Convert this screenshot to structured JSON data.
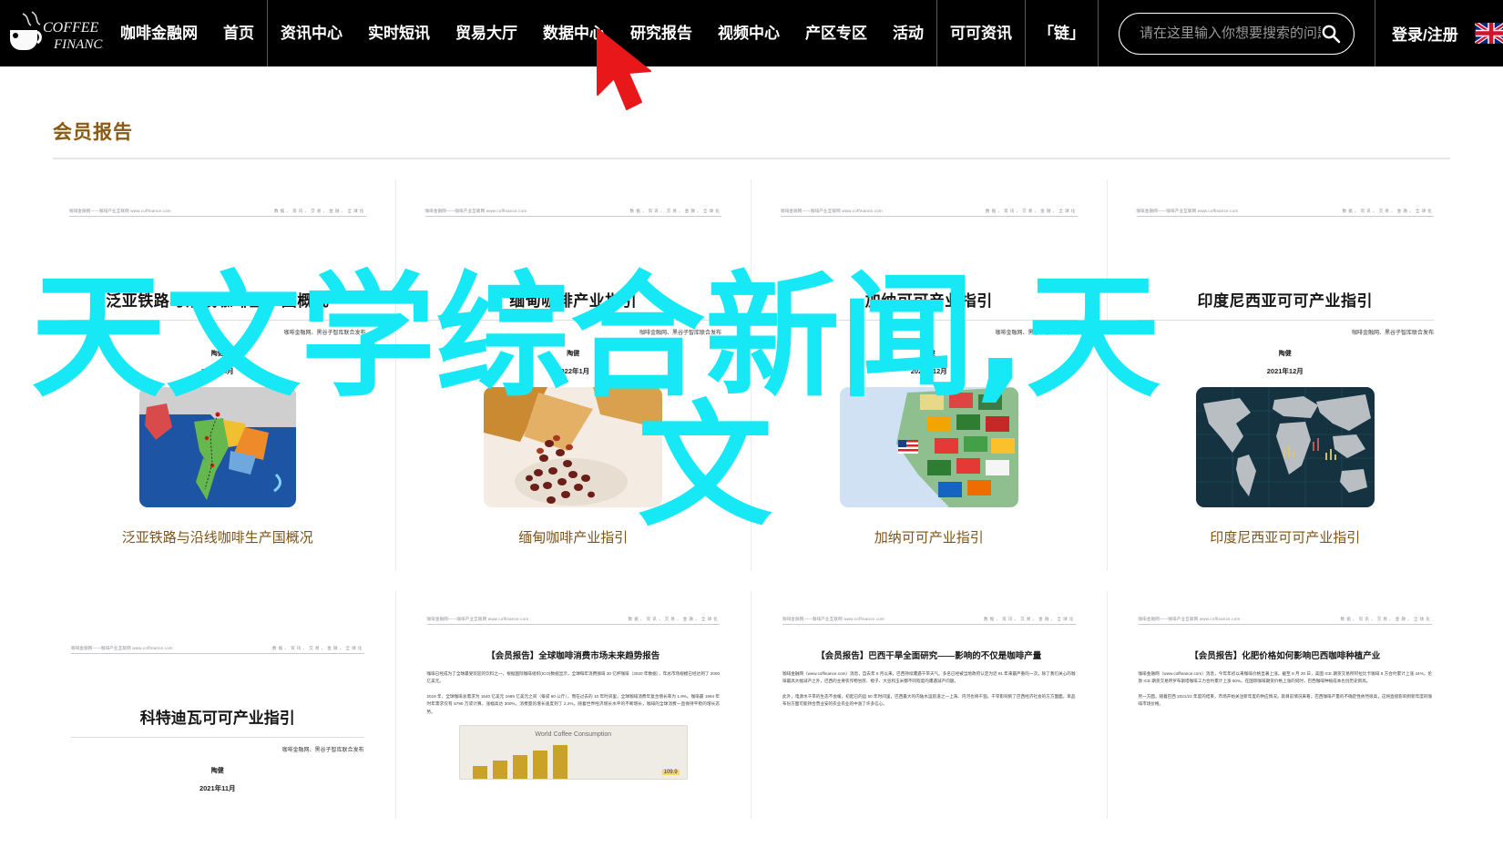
{
  "navbar": {
    "logo_text_top": "COFFEE",
    "logo_text_bottom": "FINANCE",
    "logo_icon": "coffee-cup-icon",
    "brand_items": [
      "咖啡金融网",
      "首页"
    ],
    "menu_items": [
      "资讯中心",
      "实时短讯",
      "贸易大厅",
      "数据中心",
      "研究报告",
      "视频中心",
      "产区专区",
      "活动"
    ],
    "menu_items_right": [
      "可可资讯",
      "「链」"
    ],
    "search": {
      "placeholder": "请在这里输入你想要搜索的问题",
      "value": "",
      "icon": "search-icon"
    },
    "login_label": "登录/注册",
    "flag_icon": "uk-flag-icon",
    "background_color": "#000000",
    "text_color": "#ffffff"
  },
  "page": {
    "section_title": "会员报告",
    "title_color": "#8a5a12",
    "cursor_icon": "mouse-pointer-arrow",
    "cursor_color": "#e8171a"
  },
  "watermark": {
    "line1": "天文学综合新闻,天",
    "line2": "文",
    "color": "#16e8f5"
  },
  "doc_header": {
    "left": "咖啡金融网——咖啡产业互联网 www.coffinance.com",
    "right": "数据、资讯、交易、金融、全球化"
  },
  "reports": [
    {
      "title": "泛亚铁路与沿线咖啡生产国概况",
      "caption": "泛亚铁路与沿线咖啡生产国概况",
      "publisher": "咖啡金融网、黑谷子智库联合发布",
      "author": "陶健",
      "date": "2022年4月",
      "image": "southeast-asia-railway-map"
    },
    {
      "title": "缅甸咖啡产业指引",
      "caption": "缅甸咖啡产业指引",
      "publisher": "咖啡金融网、黑谷子智库联合发布",
      "author": "陶健",
      "date": "2022年1月",
      "image": "coffee-cherries-photo"
    },
    {
      "title": "加纳可可产业指引",
      "caption": "加纳可可产业指引",
      "publisher": "咖啡金融网、黑谷子智库联合发布",
      "author": "陶健",
      "date": "2021年12月",
      "image": "west-africa-flags-map"
    },
    {
      "title": "印度尼西亚可可产业指引",
      "caption": "印度尼西亚可可产业指引",
      "publisher": "咖啡金融网、黑谷子智库联合发布",
      "author": "陶健",
      "date": "2021年12月",
      "image": "dark-world-map"
    }
  ],
  "articles": [
    {
      "title": "科特迪瓦可可可产业指引",
      "title_display": "科特迪瓦可可产业指引",
      "publisher": "咖啡金融网、黑谷子智库联合发布",
      "author": "陶健",
      "date": "2021年11月",
      "type": "cover"
    },
    {
      "title": "【会员报告】全球咖啡消费市场未来趋势报告",
      "para1": "咖啡已经成为了全球最受欢迎的饮料之一。根据国际咖啡组织(ICO)数据显示，全球每年消费咖啡 30 亿杯咖啡（2020 年数据），年总市场规模已经达到了 2000 亿美元。",
      "para2": "2019 年，全球咖啡总需求为 1640 亿美元 1665 亿美元之间（每袋 60 公斤），而在过去的 10 年时间里，全球咖啡消费年复合增长率为 1.9%。咖啡最 1964 年时年需求仅有 5790 万袋计算，涨幅高达 300%。消费量的增长速度到了 2.2%。随着世界经济增长水平的不断增长，咖啡的全球消费一直保持平稳的增长态势。",
      "chart_label": "World Coffee Consumption",
      "chart_value": "109.9",
      "type": "article"
    },
    {
      "title": "【会员报告】巴西干旱全面研究——影响的不仅是咖啡产量",
      "para1": "咖啡金融网（www.coffinance.com）消息，自去年 5 月以来，巴西持续遭遇干旱天气。多名已经被当地政府认定为近 91 年来最严重的一次。除了我们关心的咖啡最高大幅减产之外，巴西的主要农作物甘蔗、橙子、大豆和玉米都不同程度的遭遇减产问题。",
      "para2": "此外，电源水干旱的生态不会缓。初起已的运 50 年时间里，巴西最大的内陆水运航道之一上海、内河也将干涸。干旱影响到了巴西经济社会的方方面面。单品布份方面可能持合营业安的农业农业的中涨了许多信心。",
      "type": "article"
    },
    {
      "title": "【会员报告】化肥价格如何影响巴西咖啡种植产业",
      "para1": "咖啡金融网（www.coffinance.com）消息，今年年初以来咖啡价格显著上涨。截至 9 月 20 日，美国 ICE 期货交易所阿拉比卡咖啡 8 方合约累计上涨 44%，伦敦 ICE 期货交易所罗布斯塔咖啡工力合约累计上涨 50%。在国际咖啡期货价格上涨的同时，巴西咖啡种植成本也创历史新高。",
      "para2": "另一方面，随着巴西 2021/22 年度的结束，市场开始关注新年度的供应情况。就目前情况来看，巴西咖啡产量的不确定性依然很高，这将直接影响到新年度的咖啡市场价格。",
      "type": "article"
    }
  ]
}
